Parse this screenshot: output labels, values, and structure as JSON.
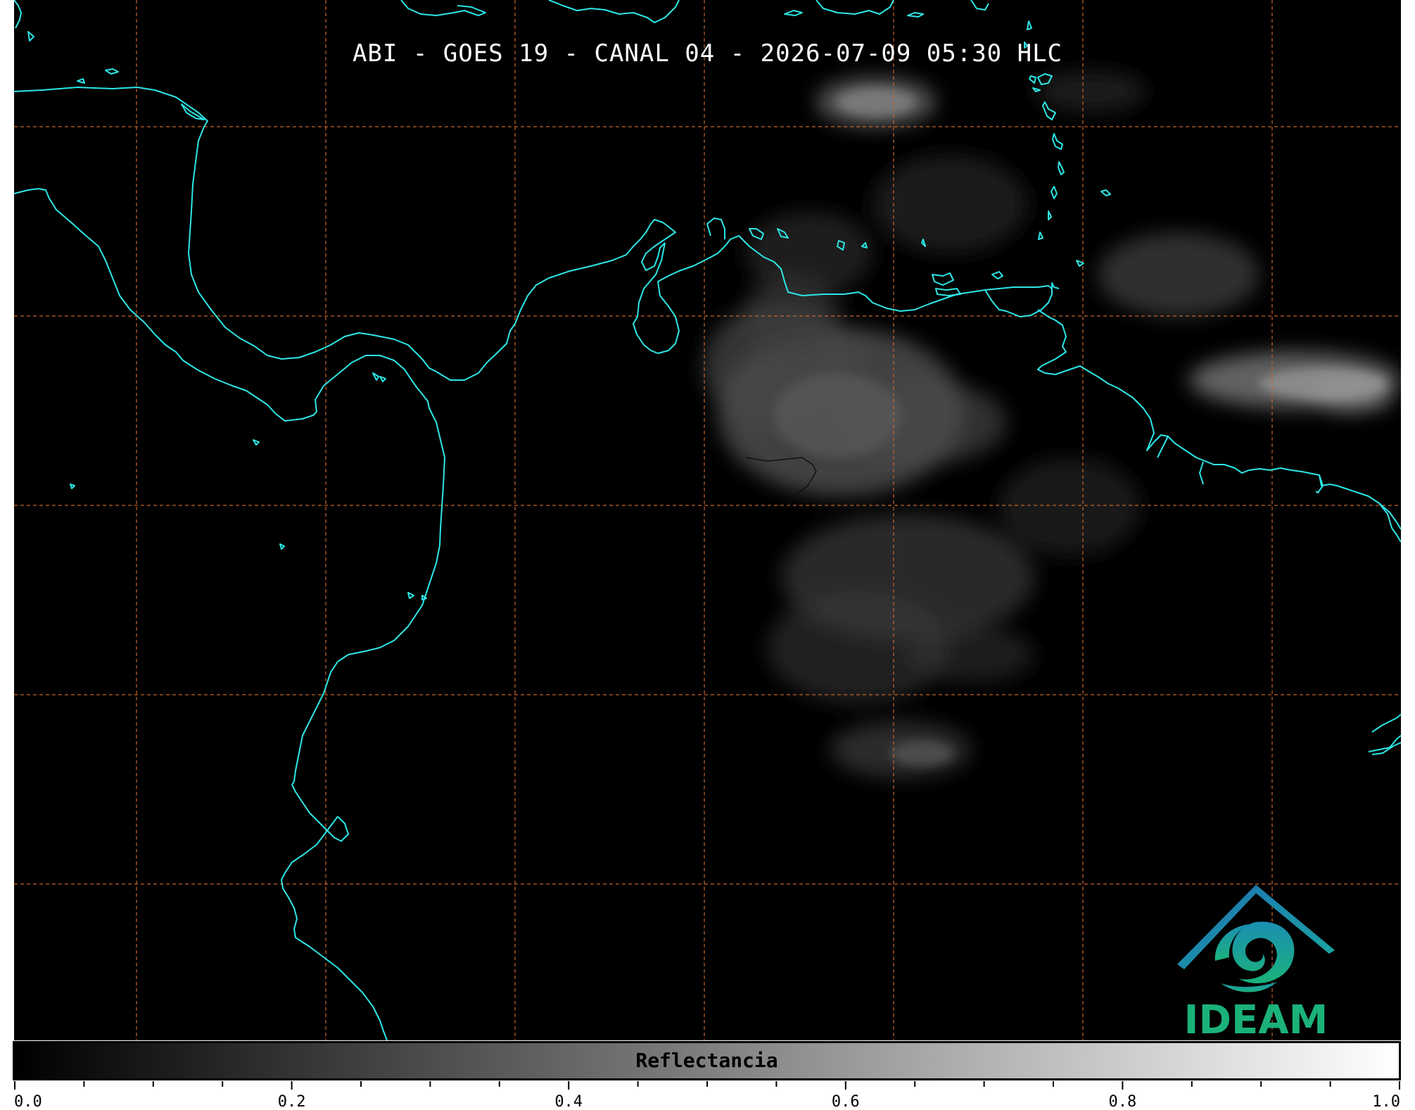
{
  "map": {
    "title": "ABI - GOES 19 - CANAL 04 - 2026-07-09 05:30 HLC",
    "background_color": "#000000",
    "coastline_color": "#2ee6e6",
    "gridline_color": "#c8642a",
    "gridlines": "dashed"
  },
  "logo": {
    "name": "ideam-logo-icon",
    "text": "IDEAM",
    "colors": [
      "#1f6fb4",
      "#19a9a0",
      "#1bb27a"
    ]
  },
  "colorbar": {
    "label": "Reflectancia",
    "range": [
      0.0,
      1.0
    ],
    "colormap": "gray",
    "tick_labels": [
      "0.0",
      "0.2",
      "0.4",
      "0.6",
      "0.8",
      "1.0"
    ],
    "major_ticks": [
      0.0,
      0.2,
      0.4,
      0.6,
      0.8,
      1.0
    ],
    "minor_tick_step": 0.05
  }
}
